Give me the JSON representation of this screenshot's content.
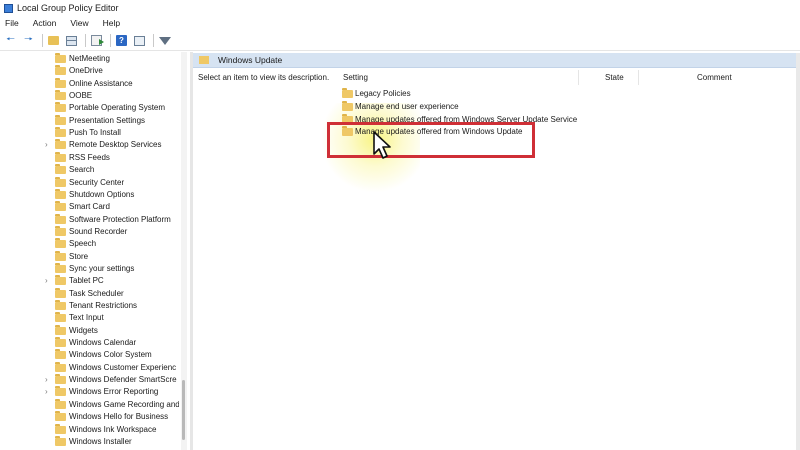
{
  "window": {
    "title": "Local Group Policy Editor"
  },
  "menu": [
    "File",
    "Action",
    "View",
    "Help"
  ],
  "toolbar": [
    "back-arrow-icon",
    "forward-arrow-icon",
    "folder-up-icon",
    "show-hide-tree-icon",
    "export-list-icon",
    "help-icon",
    "console-panel-icon",
    "filter-icon"
  ],
  "tree": {
    "items": [
      {
        "label": "NetMeeting",
        "expandable": false
      },
      {
        "label": "OneDrive",
        "expandable": false
      },
      {
        "label": "Online Assistance",
        "expandable": false
      },
      {
        "label": "OOBE",
        "expandable": false
      },
      {
        "label": "Portable Operating System",
        "expandable": false
      },
      {
        "label": "Presentation Settings",
        "expandable": false
      },
      {
        "label": "Push To Install",
        "expandable": false
      },
      {
        "label": "Remote Desktop Services",
        "expandable": true
      },
      {
        "label": "RSS Feeds",
        "expandable": false
      },
      {
        "label": "Search",
        "expandable": false
      },
      {
        "label": "Security Center",
        "expandable": false
      },
      {
        "label": "Shutdown Options",
        "expandable": false
      },
      {
        "label": "Smart Card",
        "expandable": false
      },
      {
        "label": "Software Protection Platform",
        "expandable": false
      },
      {
        "label": "Sound Recorder",
        "expandable": false
      },
      {
        "label": "Speech",
        "expandable": false
      },
      {
        "label": "Store",
        "expandable": false
      },
      {
        "label": "Sync your settings",
        "expandable": false
      },
      {
        "label": "Tablet PC",
        "expandable": true
      },
      {
        "label": "Task Scheduler",
        "expandable": false
      },
      {
        "label": "Tenant Restrictions",
        "expandable": false
      },
      {
        "label": "Text Input",
        "expandable": false
      },
      {
        "label": "Widgets",
        "expandable": false
      },
      {
        "label": "Windows Calendar",
        "expandable": false
      },
      {
        "label": "Windows Color System",
        "expandable": false
      },
      {
        "label": "Windows Customer Experienc",
        "expandable": false
      },
      {
        "label": "Windows Defender SmartScre",
        "expandable": true
      },
      {
        "label": "Windows Error Reporting",
        "expandable": true
      },
      {
        "label": "Windows Game Recording and",
        "expandable": false
      },
      {
        "label": "Windows Hello for Business",
        "expandable": false
      },
      {
        "label": "Windows Ink Workspace",
        "expandable": false
      },
      {
        "label": "Windows Installer",
        "expandable": false
      }
    ]
  },
  "detail": {
    "header": "Windows Update",
    "description": "Select an item to view its description.",
    "columns": {
      "setting": "Setting",
      "state": "State",
      "comment": "Comment"
    },
    "settings": [
      "Legacy Policies",
      "Manage end user experience",
      "Manage updates offered from Windows Server Update Service",
      "Manage updates offered from Windows Update"
    ]
  },
  "colors": {
    "highlight_box": "#cf2f36",
    "header_bg": "#d6e3f2",
    "folder": "#efc866"
  }
}
